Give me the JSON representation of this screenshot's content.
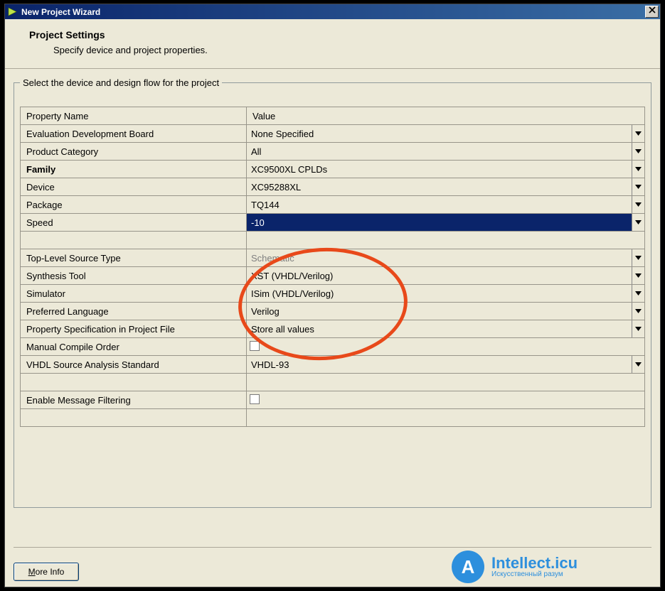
{
  "window": {
    "title": "New Project Wizard"
  },
  "header": {
    "title": "Project Settings",
    "subtitle": "Specify device and project properties."
  },
  "groupbox": {
    "legend": "Select the device and design flow for the project"
  },
  "table": {
    "columns": {
      "name": "Property Name",
      "value": "Value"
    },
    "rows": [
      {
        "label": "Evaluation Development Board",
        "value": "None Specified",
        "dropdown": true
      },
      {
        "label": "Product Category",
        "value": "All",
        "dropdown": true
      },
      {
        "label": "Family",
        "value": "XC9500XL CPLDs",
        "dropdown": true,
        "bold": true
      },
      {
        "label": "Device",
        "value": "XC95288XL",
        "dropdown": true
      },
      {
        "label": "Package",
        "value": "TQ144",
        "dropdown": true
      },
      {
        "label": "Speed",
        "value": "-10",
        "dropdown": true,
        "selected": true
      }
    ],
    "rows2": [
      {
        "label": "Top-Level Source Type",
        "value": "Schematic",
        "dropdown": true,
        "disabled": true
      },
      {
        "label": "Synthesis Tool",
        "value": "XST (VHDL/Verilog)",
        "dropdown": true
      },
      {
        "label": "Simulator",
        "value": "ISim (VHDL/Verilog)",
        "dropdown": true
      },
      {
        "label": "Preferred Language",
        "value": "Verilog",
        "dropdown": true
      },
      {
        "label": "Property Specification in Project File",
        "value": "Store all values",
        "dropdown": true
      },
      {
        "label": "Manual Compile Order",
        "value": "",
        "checkbox": true
      },
      {
        "label": "VHDL Source Analysis Standard",
        "value": "VHDL-93",
        "dropdown": true
      }
    ],
    "rows3": [
      {
        "label": "Enable Message Filtering",
        "value": "",
        "checkbox": true
      }
    ]
  },
  "footer": {
    "more_info_prefix": "M",
    "more_info_rest": "ore Info"
  },
  "watermark": {
    "glyph": "A",
    "main": "Intellect.icu",
    "sub": "Искусственный разум"
  }
}
